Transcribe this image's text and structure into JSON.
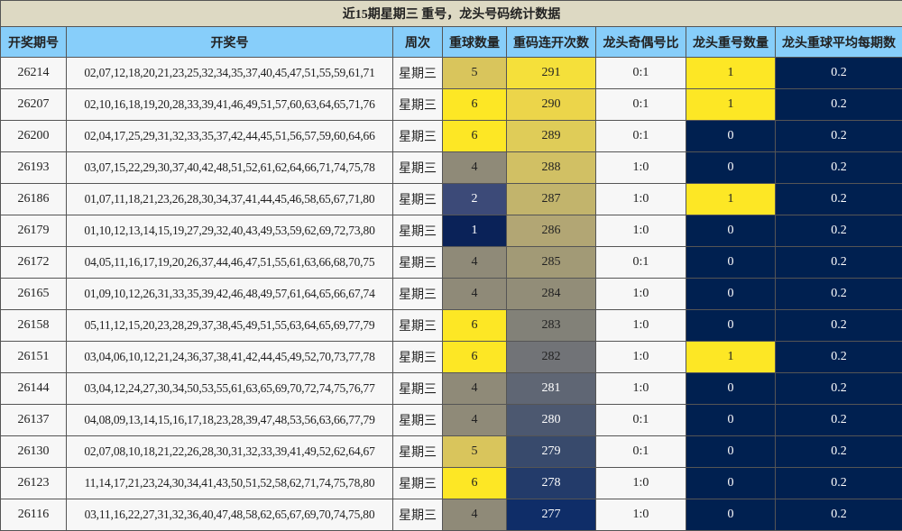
{
  "title": "近15期星期三 重号，龙头号码统计数据",
  "headers": [
    "开奖期号",
    "开奖号",
    "周次",
    "重球数量",
    "重码连开次数",
    "龙头奇偶号比",
    "龙头重号数量",
    "龙头重球平均每期数"
  ],
  "rows": [
    {
      "issue": "26214",
      "numbers": "02,07,12,18,20,21,23,25,32,34,35,37,40,45,47,51,55,59,61,71",
      "week": "星期三",
      "repeat_count": "5",
      "consecutive": "291",
      "parity": "0:1",
      "head_repeat": "1",
      "avg": "0.2"
    },
    {
      "issue": "26207",
      "numbers": "02,10,16,18,19,20,28,33,39,41,46,49,51,57,60,63,64,65,71,76",
      "week": "星期三",
      "repeat_count": "6",
      "consecutive": "290",
      "parity": "0:1",
      "head_repeat": "1",
      "avg": "0.2"
    },
    {
      "issue": "26200",
      "numbers": "02,04,17,25,29,31,32,33,35,37,42,44,45,51,56,57,59,60,64,66",
      "week": "星期三",
      "repeat_count": "6",
      "consecutive": "289",
      "parity": "0:1",
      "head_repeat": "0",
      "avg": "0.2"
    },
    {
      "issue": "26193",
      "numbers": "03,07,15,22,29,30,37,40,42,48,51,52,61,62,64,66,71,74,75,78",
      "week": "星期三",
      "repeat_count": "4",
      "consecutive": "288",
      "parity": "1:0",
      "head_repeat": "0",
      "avg": "0.2"
    },
    {
      "issue": "26186",
      "numbers": "01,07,11,18,21,23,26,28,30,34,37,41,44,45,46,58,65,67,71,80",
      "week": "星期三",
      "repeat_count": "2",
      "consecutive": "287",
      "parity": "1:0",
      "head_repeat": "1",
      "avg": "0.2"
    },
    {
      "issue": "26179",
      "numbers": "01,10,12,13,14,15,19,27,29,32,40,43,49,53,59,62,69,72,73,80",
      "week": "星期三",
      "repeat_count": "1",
      "consecutive": "286",
      "parity": "1:0",
      "head_repeat": "0",
      "avg": "0.2"
    },
    {
      "issue": "26172",
      "numbers": "04,05,11,16,17,19,20,26,37,44,46,47,51,55,61,63,66,68,70,75",
      "week": "星期三",
      "repeat_count": "4",
      "consecutive": "285",
      "parity": "0:1",
      "head_repeat": "0",
      "avg": "0.2"
    },
    {
      "issue": "26165",
      "numbers": "01,09,10,12,26,31,33,35,39,42,46,48,49,57,61,64,65,66,67,74",
      "week": "星期三",
      "repeat_count": "4",
      "consecutive": "284",
      "parity": "1:0",
      "head_repeat": "0",
      "avg": "0.2"
    },
    {
      "issue": "26158",
      "numbers": "05,11,12,15,20,23,28,29,37,38,45,49,51,55,63,64,65,69,77,79",
      "week": "星期三",
      "repeat_count": "6",
      "consecutive": "283",
      "parity": "1:0",
      "head_repeat": "0",
      "avg": "0.2"
    },
    {
      "issue": "26151",
      "numbers": "03,04,06,10,12,21,24,36,37,38,41,42,44,45,49,52,70,73,77,78",
      "week": "星期三",
      "repeat_count": "6",
      "consecutive": "282",
      "parity": "1:0",
      "head_repeat": "1",
      "avg": "0.2"
    },
    {
      "issue": "26144",
      "numbers": "03,04,12,24,27,30,34,50,53,55,61,63,65,69,70,72,74,75,76,77",
      "week": "星期三",
      "repeat_count": "4",
      "consecutive": "281",
      "parity": "1:0",
      "head_repeat": "0",
      "avg": "0.2"
    },
    {
      "issue": "26137",
      "numbers": "04,08,09,13,14,15,16,17,18,23,28,39,47,48,53,56,63,66,77,79",
      "week": "星期三",
      "repeat_count": "4",
      "consecutive": "280",
      "parity": "0:1",
      "head_repeat": "0",
      "avg": "0.2"
    },
    {
      "issue": "26130",
      "numbers": "02,07,08,10,18,21,22,26,28,30,31,32,33,39,41,49,52,62,64,67",
      "week": "星期三",
      "repeat_count": "5",
      "consecutive": "279",
      "parity": "0:1",
      "head_repeat": "0",
      "avg": "0.2"
    },
    {
      "issue": "26123",
      "numbers": "11,14,17,21,23,24,30,34,41,43,50,51,52,58,62,71,74,75,78,80",
      "week": "星期三",
      "repeat_count": "6",
      "consecutive": "278",
      "parity": "1:0",
      "head_repeat": "0",
      "avg": "0.2"
    },
    {
      "issue": "26116",
      "numbers": "03,11,16,22,27,31,32,36,40,47,48,58,62,65,67,69,70,74,75,80",
      "week": "星期三",
      "repeat_count": "4",
      "consecutive": "277",
      "parity": "1:0",
      "head_repeat": "0",
      "avg": "0.2"
    }
  ],
  "colors": {
    "title_bg": "#ddd9c3",
    "header_bg": "#87cefa",
    "row_bg": "#f7f7f7",
    "heat_high": "#fde725",
    "heat_low": "#002050",
    "repeat_colors": {
      "6": "#fde725",
      "5": "#d9c55c",
      "4": "#8f8a78",
      "2": "#3c4a78",
      "1": "#0a2258"
    },
    "consecutive_colors": [
      "#f5e03a",
      "#ecd54a",
      "#dfcc58",
      "#d1c064",
      "#c2b46c",
      "#b2a674",
      "#a29a76",
      "#928d78",
      "#828178",
      "#717377",
      "#5f6674",
      "#4c5870",
      "#384a6c",
      "#233b6a",
      "#0f2d68"
    ],
    "head_repeat_colors": {
      "1": "#fde725",
      "0": "#002050"
    },
    "avg_bg": "#002050"
  }
}
